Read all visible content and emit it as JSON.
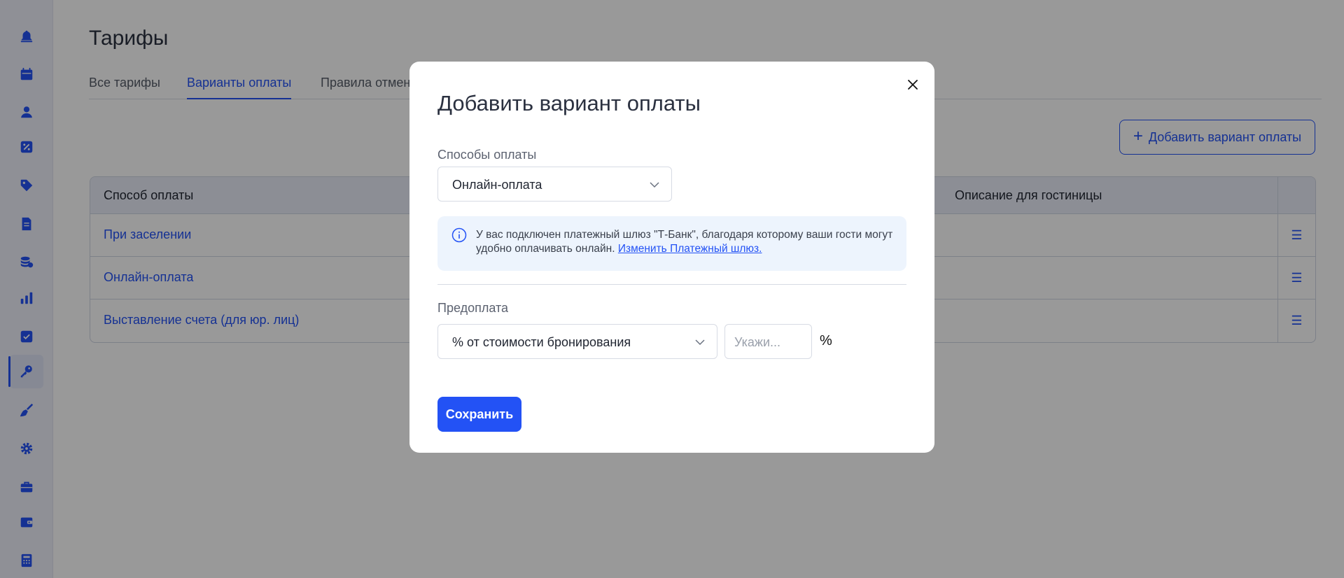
{
  "page": {
    "title": "Тарифы"
  },
  "tabs": [
    {
      "label": "Все тарифы",
      "active": false
    },
    {
      "label": "Варианты оплаты",
      "active": true
    },
    {
      "label": "Правила отмены",
      "active": false
    }
  ],
  "add_button": {
    "label": "Добавить вариант оплаты"
  },
  "table": {
    "headers": [
      "Способ оплаты",
      "Описание для гостиницы"
    ],
    "rows": [
      {
        "name": "При заселении"
      },
      {
        "name": "Онлайн-оплата"
      },
      {
        "name": "Выставление счета (для юр. лиц)"
      }
    ]
  },
  "modal": {
    "title": "Добавить вариант оплаты",
    "payment_methods_label": "Способы оплаты",
    "payment_method_value": "Онлайн-оплата",
    "info_text": "У вас подключен платежный шлюз \"Т-Банк\", благодаря которому ваши гости могут удобно оплачивать онлайн.",
    "info_link": "Изменить Платежный шлюз.",
    "prepayment_label": "Предоплата",
    "prepayment_type": "% от стоимости бронирования",
    "prepayment_placeholder": "Укажи...",
    "percent_symbol": "%",
    "save_label": "Сохранить"
  },
  "colors": {
    "accent": "#2352f5",
    "overlay": "rgba(0,0,0,0.4)"
  },
  "sidebar_icons": [
    "bell-icon",
    "calendar-icon",
    "user-icon",
    "percent-icon",
    "tag-icon",
    "document-icon",
    "coins-icon",
    "chart-icon",
    "checkbox-icon",
    "key-icon",
    "broom-icon",
    "gear-icon",
    "briefcase-icon",
    "wallet-icon",
    "calculator-icon"
  ]
}
